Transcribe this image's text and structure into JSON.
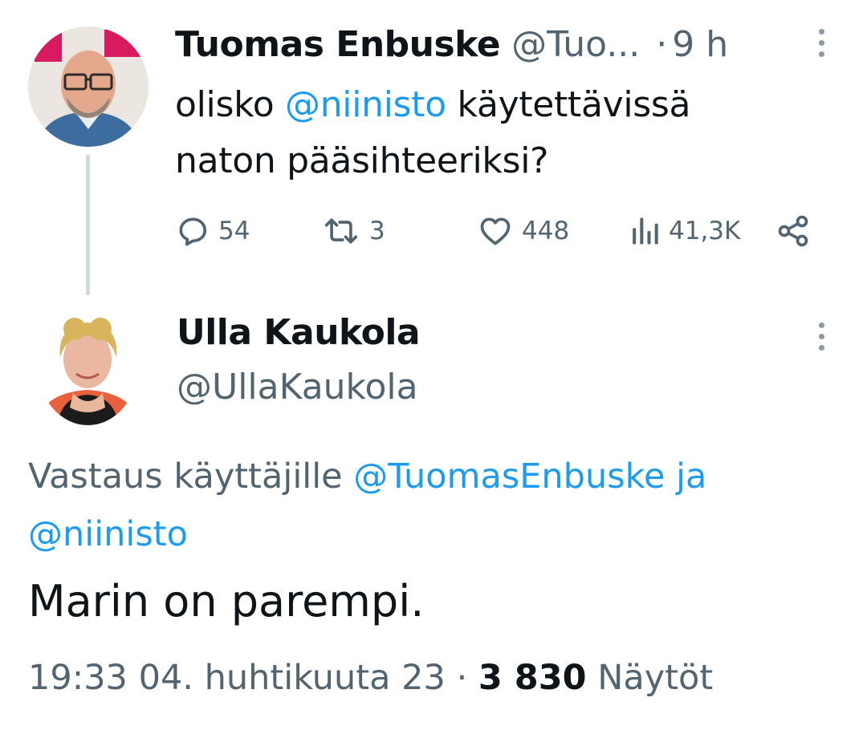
{
  "parent_tweet": {
    "author_name": "Tuomas Enbuske",
    "author_handle": "@Tuo...",
    "separator": "·",
    "time": "9 h",
    "text_before": "olisko ",
    "mention": "@niinisto",
    "text_after": " käytettävissä naton pääsihteeriksi?",
    "actions": {
      "replies": "54",
      "retweets": "3",
      "likes": "448",
      "views": "41,3K"
    },
    "avatar_icon": "profile-photo-man-glasses",
    "icons": [
      "reply-icon",
      "retweet-icon",
      "like-icon",
      "views-icon",
      "share-icon",
      "more-icon"
    ]
  },
  "reply_tweet": {
    "author_name": "Ulla Kaukola",
    "author_handle": "@UllaKaukola",
    "avatar_icon": "profile-photo-woman",
    "replying_prefix": "Vastaus käyttäjille ",
    "replying_mention1": "@TuomasEnbuske",
    "replying_conjunction": " ja",
    "replying_mention2": "@niinisto",
    "text": "Marin on parempi.",
    "timestamp": "19:33 04. huhtikuuta 23",
    "separator": "·",
    "views_count": "3 830",
    "views_label": "Näytöt"
  },
  "colors": {
    "text": "#0f1419",
    "muted": "#536471",
    "link": "#1d9bf0",
    "thread_line": "#cfd9de"
  }
}
